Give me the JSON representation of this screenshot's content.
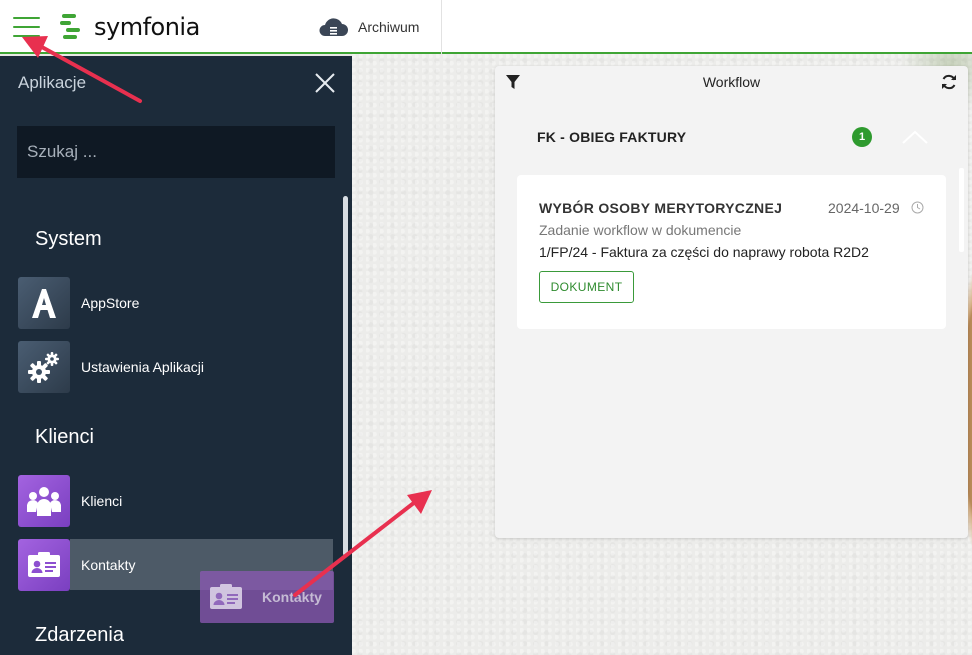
{
  "topbar": {
    "logo_text": "symfonia",
    "app_tab_label": "Archiwum"
  },
  "sidebar": {
    "title": "Aplikacje",
    "search_placeholder": "Szukaj ...",
    "sections": [
      {
        "title": "System"
      },
      {
        "title": "Klienci"
      },
      {
        "title": "Zdarzenia"
      }
    ],
    "items": [
      {
        "label": "AppStore",
        "icon": "letter-a-icon",
        "color": "#3c4f62"
      },
      {
        "label": "Ustawienia Aplikacji",
        "icon": "gears-icon",
        "color": "#3c4f62"
      },
      {
        "label": "Klienci",
        "icon": "people-group-icon",
        "color": "#8d4fd0"
      },
      {
        "label": "Kontakty",
        "icon": "contact-card-icon",
        "color": "#8d4fd0"
      }
    ],
    "drag_ghost_label": "Kontakty"
  },
  "widget": {
    "title": "Workflow",
    "group_title": "FK - OBIEG FAKTURY",
    "group_count": "1",
    "task": {
      "title": "WYBÓR OSOBY MERYTORYCZNEJ",
      "date": "2024-10-29",
      "subtitle": "Zadanie workflow w dokumencie",
      "document": "1/FP/24 - Faktura za części do naprawy robota R2D2",
      "button_label": "DOKUMENT"
    }
  },
  "colors": {
    "brand_green": "#3fa535",
    "sidebar_bg": "#1c2b3a",
    "purple_tile": "#8d4fd0",
    "annotation_arrow": "#e8304f"
  }
}
